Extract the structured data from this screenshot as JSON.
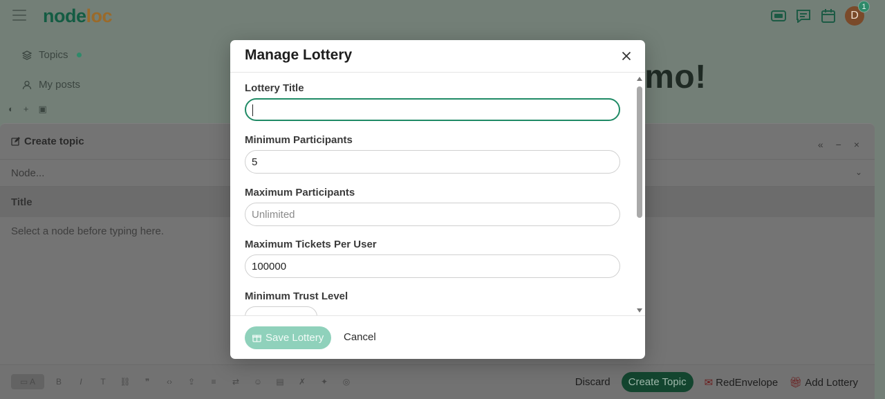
{
  "header": {
    "logo_part1": "node",
    "logo_part2": "l",
    "logo_part3": "o",
    "logo_part4": "c",
    "avatar_letter": "D",
    "notification_count": "1"
  },
  "sidenav": {
    "items": [
      {
        "label": "Topics",
        "icon": "layers-icon"
      },
      {
        "label": "My posts",
        "icon": "user-icon"
      }
    ]
  },
  "hero": {
    "text": "emo!"
  },
  "composer": {
    "title": "Create topic",
    "node_placeholder": "Node...",
    "title_placeholder": "Title",
    "body_placeholder": "Select a node before typing here.",
    "discard_label": "Discard",
    "create_label": "Create Topic",
    "redenvelope_label": "RedEnvelope",
    "add_lottery_label": "Add Lottery"
  },
  "modal": {
    "title": "Manage Lottery",
    "fields": {
      "lottery_title": {
        "label": "Lottery Title",
        "value": ""
      },
      "min_participants": {
        "label": "Minimum Participants",
        "value": "5"
      },
      "max_participants": {
        "label": "Maximum Participants",
        "value": "",
        "placeholder": "Unlimited"
      },
      "max_tickets": {
        "label": "Maximum Tickets Per User",
        "value": "100000"
      },
      "min_trust": {
        "label": "Minimum Trust Level"
      }
    },
    "save_label": "Save Lottery",
    "cancel_label": "Cancel"
  },
  "colors": {
    "accent": "#1f8a65",
    "save_button": "#8fd1bb",
    "create_button": "#13452f"
  }
}
